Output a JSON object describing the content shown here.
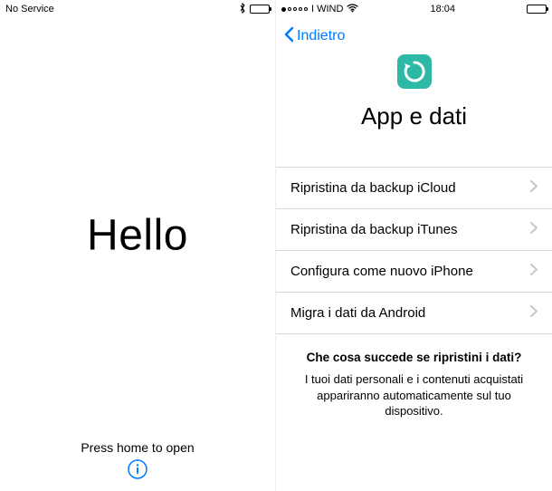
{
  "left": {
    "status": {
      "service": "No Service",
      "bluetooth": "✱"
    },
    "hello": "Hello",
    "press_home": "Press home to open"
  },
  "right": {
    "status": {
      "carrier": "I WIND",
      "time": "18:04"
    },
    "nav": {
      "back": "Indietro"
    },
    "title": "App e dati",
    "options": [
      "Ripristina da backup iCloud",
      "Ripristina da backup iTunes",
      "Configura come nuovo iPhone",
      "Migra i dati da Android"
    ],
    "info": {
      "title": "Che cosa succede se ripristini i dati?",
      "body": "I tuoi dati personali e i contenuti acquistati appariranno automaticamente sul tuo dispositivo."
    }
  },
  "colors": {
    "accent": "#007aff",
    "icon_bg": "#2eb8a6"
  }
}
